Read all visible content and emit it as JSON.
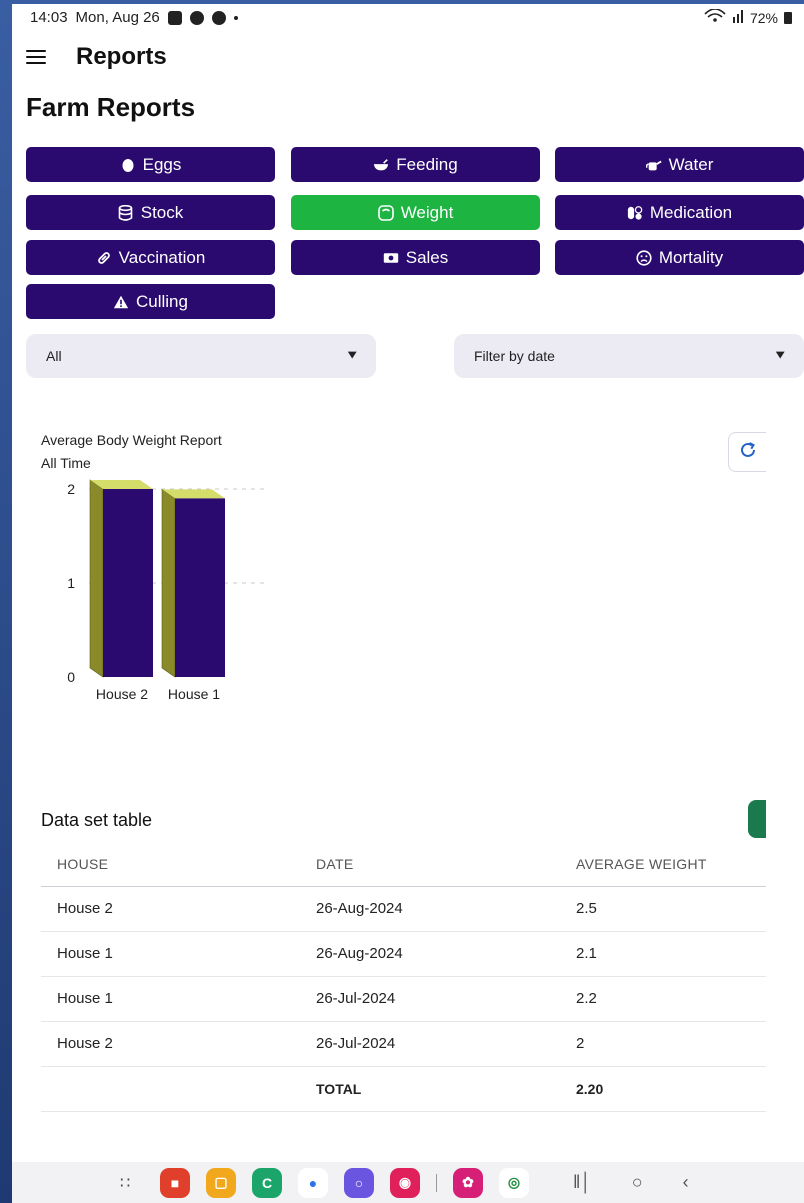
{
  "status_bar": {
    "time": "14:03",
    "date": "Mon, Aug 26",
    "battery": "72%"
  },
  "app_bar": {
    "title": "Reports"
  },
  "page_title": "Farm Reports",
  "report_buttons": [
    {
      "label": "Eggs",
      "icon": "egg-icon",
      "active": false
    },
    {
      "label": "Feeding",
      "icon": "bowl-icon",
      "active": false
    },
    {
      "label": "Water",
      "icon": "watering-can-icon",
      "active": false
    },
    {
      "label": "Stock",
      "icon": "database-icon",
      "active": false
    },
    {
      "label": "Weight",
      "icon": "scale-icon",
      "active": true
    },
    {
      "label": "Medication",
      "icon": "pills-icon",
      "active": false
    },
    {
      "label": "Vaccination",
      "icon": "syringe-icon",
      "active": false
    },
    {
      "label": "Sales",
      "icon": "money-icon",
      "active": false
    },
    {
      "label": "Mortality",
      "icon": "sad-face-icon",
      "active": false
    },
    {
      "label": "Culling",
      "icon": "warning-icon",
      "active": false
    }
  ],
  "filters": {
    "house": {
      "value": "All"
    },
    "date": {
      "value": "Filter by date"
    }
  },
  "colors": {
    "button_bg": "#2a0a6e",
    "button_active": "#1db441",
    "bar_front": "#2a0a6e",
    "bar_side": "#8a8a2a",
    "bar_top": "#d4dc6a"
  },
  "chart": {
    "title": "Average Body Weight Report",
    "subtitle": "All Time"
  },
  "chart_data": {
    "type": "bar",
    "title": "Average Body Weight Report",
    "subtitle": "All Time",
    "categories": [
      "House 2",
      "House 1"
    ],
    "values": [
      2.0,
      1.9
    ],
    "yticks": [
      "0",
      "1",
      "2"
    ],
    "ylim": [
      0,
      2.1
    ],
    "grid": true,
    "style": "3d"
  },
  "dataset": {
    "title": "Data set table",
    "columns": [
      "HOUSE",
      "DATE",
      "AVERAGE WEIGHT"
    ],
    "rows": [
      [
        "House 2",
        "26-Aug-2024",
        "2.5"
      ],
      [
        "House 1",
        "26-Aug-2024",
        "2.1"
      ],
      [
        "House 1",
        "26-Jul-2024",
        "2.2"
      ],
      [
        "House 2",
        "26-Jul-2024",
        "2"
      ]
    ],
    "total_label": "TOTAL",
    "total_value": "2.20"
  }
}
